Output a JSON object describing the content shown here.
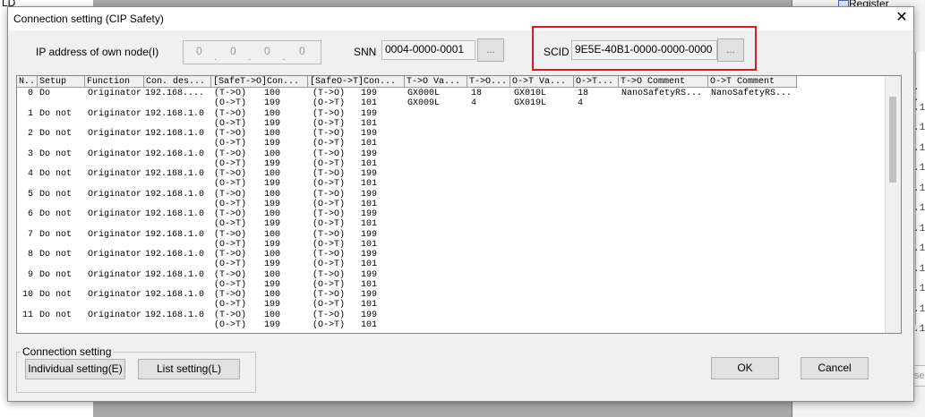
{
  "background": {
    "left_label": "LD",
    "register_label": "Register",
    "right_fragments": [
      ". .",
      ".1(",
      ".1(",
      ".1(",
      ".1(",
      ".1(",
      ".1(",
      ".1(",
      ".1(",
      ".1(",
      ".1(",
      ".1(",
      ".1("
    ],
    "right_button_label": "se"
  },
  "dialog": {
    "title": "Connection setting (CIP Safety)",
    "ip_label": "IP address of own node(I)",
    "ip_segments": [
      "0",
      "0",
      "0",
      "0"
    ],
    "snn_label": "SNN",
    "snn_value": "0004-0000-0001",
    "scid_label": "SCID",
    "scid_value": "9E5E-40B1-0000-0000-0000",
    "browse_label": "...",
    "close_glyph": "✕",
    "highlight_color": "#d42020"
  },
  "table": {
    "columns": [
      "N..",
      "Setup",
      "Function",
      "Con. des...",
      "[SafeT->O]Con...",
      "[SafeO->T]Con...",
      "T->O Va...",
      "T->O...",
      "O->T Va...",
      "O->T...",
      "T->O Comment",
      "O->T Comment"
    ],
    "rows": [
      {
        "no": "0",
        "setup": "Do",
        "function": "Originator",
        "dest": "192.168....",
        "safe_to": [
          "(T->O)",
          "(O->T)"
        ],
        "safe_to_val": [
          "100",
          "199"
        ],
        "safe_ot": [
          "(T->O)",
          "(O->T)"
        ],
        "safe_ot_val": [
          "199",
          "101"
        ],
        "to_var": [
          "GX000L",
          "GX009L"
        ],
        "to_size": [
          "18",
          "4"
        ],
        "ot_var": [
          "GX010L",
          "GX019L"
        ],
        "ot_size": [
          "18",
          "4"
        ],
        "to_comment": "NanoSafetyRS...",
        "ot_comment": "NanoSafetyRS..."
      },
      {
        "no": "1",
        "setup": "Do not",
        "function": "Originator",
        "dest": "192.168.1.0",
        "safe_to": [
          "(T->O)",
          "(O->T)"
        ],
        "safe_to_val": [
          "100",
          "199"
        ],
        "safe_ot": [
          "(T->O)",
          "(O->T)"
        ],
        "safe_ot_val": [
          "199",
          "101"
        ]
      },
      {
        "no": "2",
        "setup": "Do not",
        "function": "Originator",
        "dest": "192.168.1.0",
        "safe_to": [
          "(T->O)",
          "(O->T)"
        ],
        "safe_to_val": [
          "100",
          "199"
        ],
        "safe_ot": [
          "(T->O)",
          "(O->T)"
        ],
        "safe_ot_val": [
          "199",
          "101"
        ]
      },
      {
        "no": "3",
        "setup": "Do not",
        "function": "Originator",
        "dest": "192.168.1.0",
        "safe_to": [
          "(T->O)",
          "(O->T)"
        ],
        "safe_to_val": [
          "100",
          "199"
        ],
        "safe_ot": [
          "(T->O)",
          "(O->T)"
        ],
        "safe_ot_val": [
          "199",
          "101"
        ]
      },
      {
        "no": "4",
        "setup": "Do not",
        "function": "Originator",
        "dest": "192.168.1.0",
        "safe_to": [
          "(T->O)",
          "(O->T)"
        ],
        "safe_to_val": [
          "100",
          "199"
        ],
        "safe_ot": [
          "(T->O)",
          "(O->T)"
        ],
        "safe_ot_val": [
          "199",
          "101"
        ]
      },
      {
        "no": "5",
        "setup": "Do not",
        "function": "Originator",
        "dest": "192.168.1.0",
        "safe_to": [
          "(T->O)",
          "(O->T)"
        ],
        "safe_to_val": [
          "100",
          "199"
        ],
        "safe_ot": [
          "(T->O)",
          "(O->T)"
        ],
        "safe_ot_val": [
          "199",
          "101"
        ]
      },
      {
        "no": "6",
        "setup": "Do not",
        "function": "Originator",
        "dest": "192.168.1.0",
        "safe_to": [
          "(T->O)",
          "(O->T)"
        ],
        "safe_to_val": [
          "100",
          "199"
        ],
        "safe_ot": [
          "(T->O)",
          "(O->T)"
        ],
        "safe_ot_val": [
          "199",
          "101"
        ]
      },
      {
        "no": "7",
        "setup": "Do not",
        "function": "Originator",
        "dest": "192.168.1.0",
        "safe_to": [
          "(T->O)",
          "(O->T)"
        ],
        "safe_to_val": [
          "100",
          "199"
        ],
        "safe_ot": [
          "(T->O)",
          "(O->T)"
        ],
        "safe_ot_val": [
          "199",
          "101"
        ]
      },
      {
        "no": "8",
        "setup": "Do not",
        "function": "Originator",
        "dest": "192.168.1.0",
        "safe_to": [
          "(T->O)",
          "(O->T)"
        ],
        "safe_to_val": [
          "100",
          "199"
        ],
        "safe_ot": [
          "(T->O)",
          "(O->T)"
        ],
        "safe_ot_val": [
          "199",
          "101"
        ]
      },
      {
        "no": "9",
        "setup": "Do not",
        "function": "Originator",
        "dest": "192.168.1.0",
        "safe_to": [
          "(T->O)",
          "(O->T)"
        ],
        "safe_to_val": [
          "100",
          "199"
        ],
        "safe_ot": [
          "(T->O)",
          "(O->T)"
        ],
        "safe_ot_val": [
          "199",
          "101"
        ]
      },
      {
        "no": "10",
        "setup": "Do not",
        "function": "Originator",
        "dest": "192.168.1.0",
        "safe_to": [
          "(T->O)",
          "(O->T)"
        ],
        "safe_to_val": [
          "100",
          "199"
        ],
        "safe_ot": [
          "(T->O)",
          "(O->T)"
        ],
        "safe_ot_val": [
          "199",
          "101"
        ]
      },
      {
        "no": "11",
        "setup": "Do not",
        "function": "Originator",
        "dest": "192.168.1.0",
        "safe_to": [
          "(T->O)",
          "(O->T)"
        ],
        "safe_to_val": [
          "100",
          "199"
        ],
        "safe_ot": [
          "(T->O)",
          "(O->T)"
        ],
        "safe_ot_val": [
          "199",
          "101"
        ]
      }
    ]
  },
  "connection_group": {
    "legend": "Connection setting",
    "individual_label": "Individual setting(E)",
    "list_label": "List setting(L)"
  },
  "buttons": {
    "ok": "OK",
    "cancel": "Cancel"
  }
}
